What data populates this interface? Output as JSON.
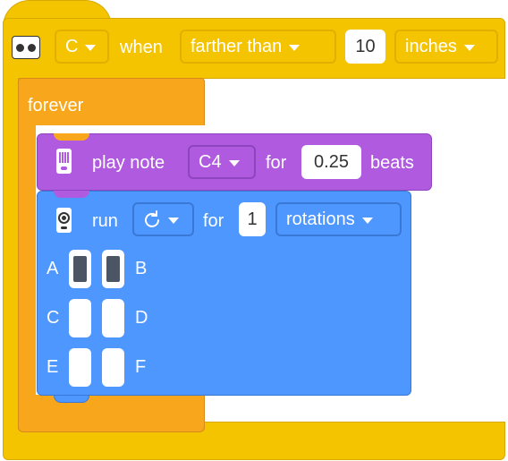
{
  "hat": {
    "port_value": "C",
    "when_label": "when",
    "condition_value": "farther than",
    "distance_value": "10",
    "unit_value": "inches",
    "icon": "distance-sensor-icon"
  },
  "forever": {
    "label": "forever"
  },
  "sound_block": {
    "play_label": "play note",
    "note_value": "C4",
    "for_label": "for",
    "beats_value": "0.25",
    "beats_label": "beats",
    "icon": "hub-icon"
  },
  "motor_block": {
    "run_label": "run",
    "direction_icon": "rotate-clockwise-icon",
    "for_label": "for",
    "amount_value": "1",
    "unit_value": "rotations",
    "icon": "motor-icon",
    "ports": [
      {
        "left": "A",
        "right": "B",
        "left_selected": true,
        "right_selected": true
      },
      {
        "left": "C",
        "right": "D",
        "left_selected": false,
        "right_selected": false
      },
      {
        "left": "E",
        "right": "F",
        "left_selected": false,
        "right_selected": false
      }
    ]
  },
  "colors": {
    "events_yellow": "#f5c400",
    "control_orange": "#f8a71d",
    "sound_purple": "#b05ae0",
    "motor_blue": "#4d97ff"
  }
}
